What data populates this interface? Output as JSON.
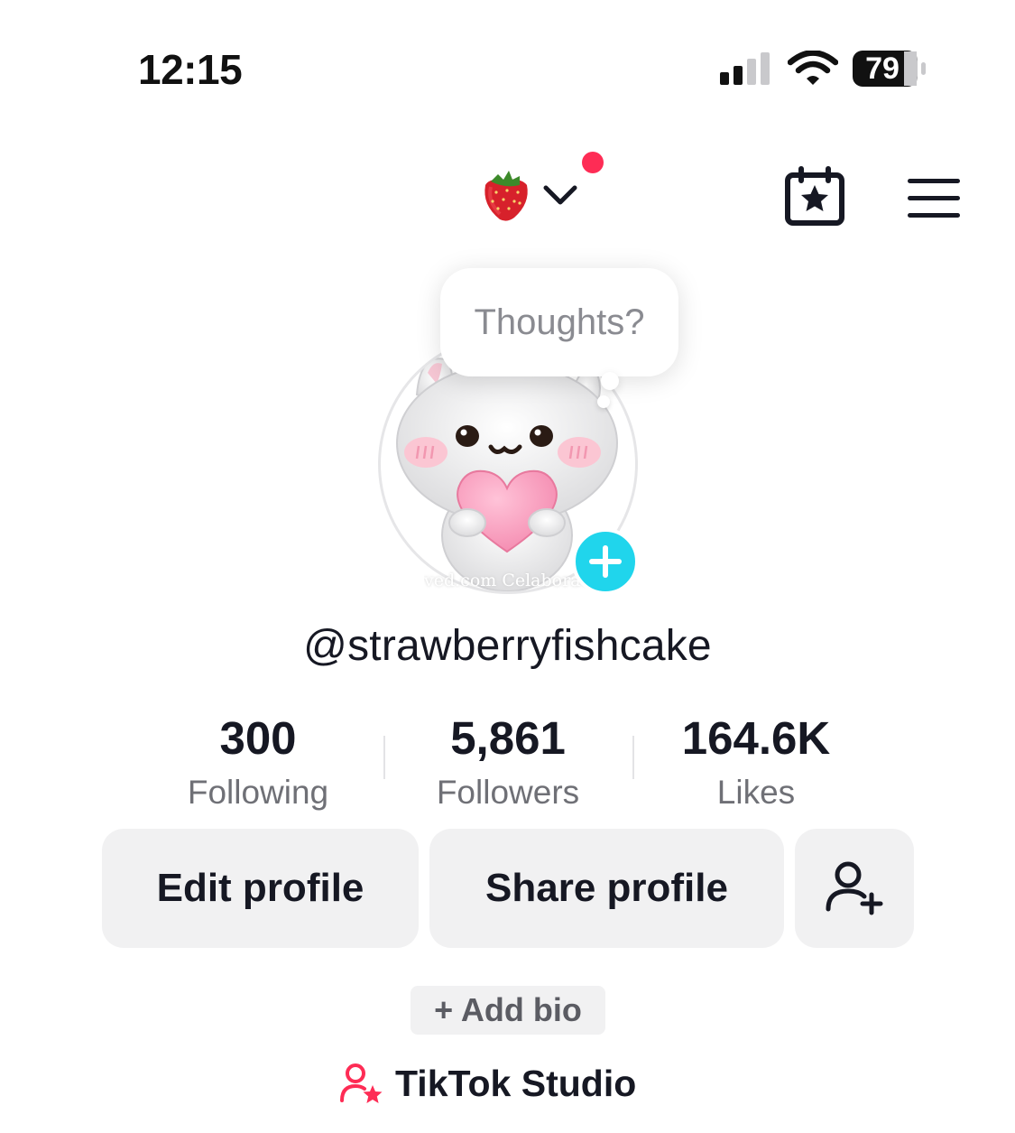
{
  "status_bar": {
    "time": "12:15",
    "battery": "79",
    "icons": [
      "cellular-signal-icon",
      "wifi-icon",
      "battery-icon"
    ]
  },
  "header": {
    "account_emoji": "🍓",
    "icons": [
      "strawberry-icon",
      "chevron-down-icon",
      "calendar-star-icon",
      "hamburger-menu-icon"
    ],
    "notification_color": "#fe2c55"
  },
  "profile": {
    "bubble_text": "Thoughts?",
    "avatar_watermark": "ved.com  Celaborac",
    "username": "@strawberryfishcake",
    "add_avatar_color": "#20d5ec"
  },
  "stats": [
    {
      "value": "300",
      "label": "Following"
    },
    {
      "value": "5,861",
      "label": "Followers"
    },
    {
      "value": "164.6K",
      "label": "Likes"
    }
  ],
  "actions": {
    "edit": "Edit profile",
    "share": "Share profile",
    "add_friend_icon": "add-person-icon"
  },
  "bio": {
    "add_label": "+ Add bio"
  },
  "studio": {
    "label": "TikTok Studio",
    "icon": "person-star-icon",
    "accent": "#fe2c55"
  }
}
